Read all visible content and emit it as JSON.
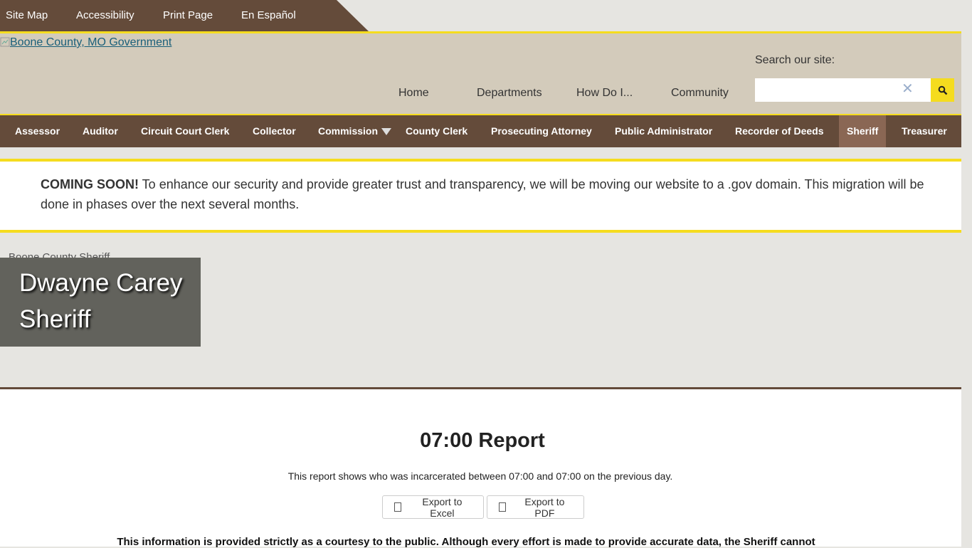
{
  "utility": {
    "links": [
      "Site Map",
      "Accessibility",
      "Print Page",
      "En Español"
    ]
  },
  "header": {
    "logo_alt": "Boone County, MO Government",
    "nav": [
      "Home",
      "Departments",
      "How Do I...",
      "Community"
    ],
    "search_label": "Search our site:",
    "search_value": "",
    "clear_glyph": "✕"
  },
  "departments": [
    "Assessor",
    "Auditor",
    "Circuit Court Clerk",
    "Collector",
    "Commission",
    "County Clerk",
    "Prosecuting Attorney",
    "Public Administrator",
    "Recorder of Deeds",
    "Sheriff",
    "Treasurer"
  ],
  "announcement": {
    "lead": "COMING SOON!",
    "text": " To enhance our security and provide greater trust and transparency, we will be moving our website to a .gov domain. This migration will be done in phases over the next several months."
  },
  "hero": {
    "image_alt": "Boone County Sheriff",
    "name": "Dwayne Carey",
    "title": "Sheriff"
  },
  "report": {
    "title": "07:00 Report",
    "description": "This report shows who was incarcerated between 07:00 and 07:00 on the previous day.",
    "export_excel": "Export to Excel",
    "export_pdf": "Export to PDF",
    "disclaimer": "This information is provided strictly as a courtesy to the public. Although every effort is made to provide accurate data, the Sheriff cannot"
  },
  "colors": {
    "brown": "#644b3a",
    "yellow": "#f5dc1e",
    "tan": "#d3cbbb",
    "active_tab": "#8a6754"
  }
}
